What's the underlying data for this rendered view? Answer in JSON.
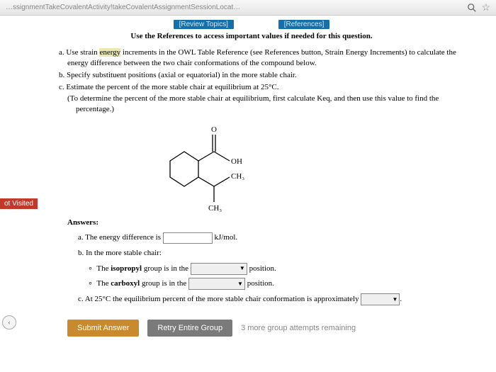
{
  "browser": {
    "url_fragment": "…ssignmentTakeCovalentActivity!takeCovalentAssignmentSessionLocat…",
    "search_icon": "search-icon",
    "star_icon": "star-icon"
  },
  "top_links": {
    "review": "[Review Topics]",
    "references": "[References]"
  },
  "hint": "Use the References to access important values if needed for this question.",
  "instructions": {
    "a": "a. Use strain energy increments in the OWL Table Reference (see References button, Strain Energy Increments) to calculate the energy difference between the two chair conformations of the compound below.",
    "b": "b. Specify substituent positions (axial or equatorial) in the more stable chair.",
    "c": "c. Estimate the percent of the more stable chair at equilibrium at 25°C.",
    "c_sub": "(To determine the percent of the more stable chair at equilibrium, first calculate Keq, and then use this value to find the percentage.)"
  },
  "molecule": {
    "labels": {
      "o": "O",
      "oh": "OH",
      "ch3_a": "CH₃",
      "ch3_b": "CH₃"
    }
  },
  "answers_label": "Answers:",
  "answers": {
    "a_pre": "a. The energy difference is",
    "a_unit": "kJ/mol.",
    "b_head": "b. In the more stable chair:",
    "b_iso_pre": "∘  The isopropyl group is in the",
    "b_iso_post": "position.",
    "b_carb_pre": "∘  The carboxyl group is in the",
    "b_carb_post": "position.",
    "c_pre": "c. At 25°C the equilibrium percent of the more stable chair conformation is approximately",
    "dropdown_blank": " "
  },
  "buttons": {
    "submit": "Submit Answer",
    "retry": "Retry Entire Group",
    "attempts": "3 more group attempts remaining"
  },
  "sidebar": {
    "not_visited": "ot Visited",
    "nav_prev": "‹"
  }
}
